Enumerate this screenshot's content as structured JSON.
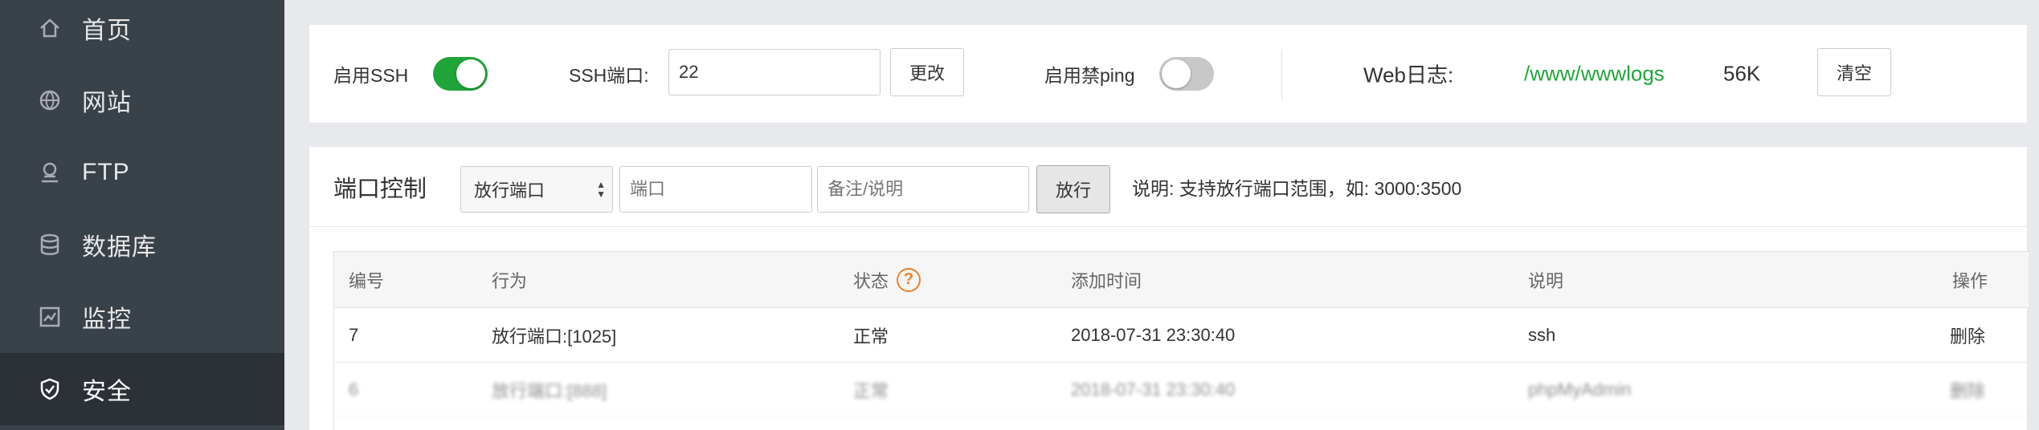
{
  "sidebar": {
    "items": [
      {
        "label": "首页",
        "icon": "home-icon"
      },
      {
        "label": "网站",
        "icon": "globe-icon"
      },
      {
        "label": "FTP",
        "icon": "ftp-icon"
      },
      {
        "label": "数据库",
        "icon": "database-icon"
      },
      {
        "label": "监控",
        "icon": "monitor-icon"
      },
      {
        "label": "安全",
        "icon": "shield-icon",
        "active": true
      }
    ]
  },
  "settings": {
    "ssh_enable_label": "启用SSH",
    "ssh_enabled": true,
    "ssh_port_label": "SSH端口:",
    "ssh_port_value": "22",
    "change_button": "更改",
    "ping_label": "启用禁ping",
    "ping_enabled": false,
    "weblog_label": "Web日志:",
    "weblog_path": "/www/wwwlogs",
    "weblog_size": "56K",
    "clear_button": "清空"
  },
  "port_control": {
    "title": "端口控制",
    "select_value": "放行端口",
    "port_placeholder": "端口",
    "note_placeholder": "备注/说明",
    "allow_button": "放行",
    "hint": "说明: 支持放行端口范围，如: 3000:3500"
  },
  "table": {
    "headers": {
      "id": "编号",
      "action": "行为",
      "status": "状态",
      "added": "添加时间",
      "desc": "说明",
      "ops": "操作"
    },
    "help_icon": "?",
    "rows": [
      {
        "id": "7",
        "action": "放行端口:[1025]",
        "status": "正常",
        "added": "2018-07-31 23:30:40",
        "desc": "ssh",
        "op": "删除"
      },
      {
        "id": "6",
        "action": "放行端口:[888]",
        "status": "正常",
        "added": "2018-07-31 23:30:40",
        "desc": "phpMyAdmin",
        "op": "删除"
      }
    ]
  },
  "colors": {
    "sidebar_bg": "#394149",
    "sidebar_active": "#2b3137",
    "accent_green": "#20a53a",
    "help_orange": "#f07f2a"
  }
}
